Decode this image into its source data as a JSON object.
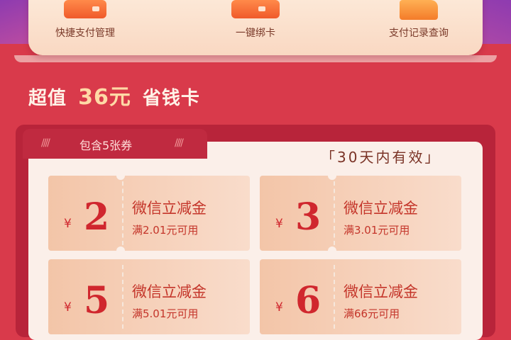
{
  "quick_actions": [
    {
      "label": "快捷支付管理",
      "icon": "wallet-icon"
    },
    {
      "label": "一键绑卡",
      "icon": "card-icon"
    },
    {
      "label": "支付记录查询",
      "icon": "folder-icon"
    }
  ],
  "card": {
    "headline_prefix": "超值",
    "headline_amount": "36元",
    "headline_suffix": "省钱卡",
    "tab_label": "包含5张券",
    "validity": "「30天内有效」"
  },
  "coupons": [
    {
      "currency": "¥",
      "value": "2",
      "title": "微信立减金",
      "condition": "满2.01元可用"
    },
    {
      "currency": "¥",
      "value": "3",
      "title": "微信立减金",
      "condition": "满3.01元可用"
    },
    {
      "currency": "¥",
      "value": "5",
      "title": "微信立减金",
      "condition": "满5.01元可用"
    },
    {
      "currency": "¥",
      "value": "6",
      "title": "微信立减金",
      "condition": "满66元可用"
    }
  ],
  "colors": {
    "background": "#d93a4b",
    "accent": "#d0272e",
    "gold": "#ffd9a6"
  }
}
